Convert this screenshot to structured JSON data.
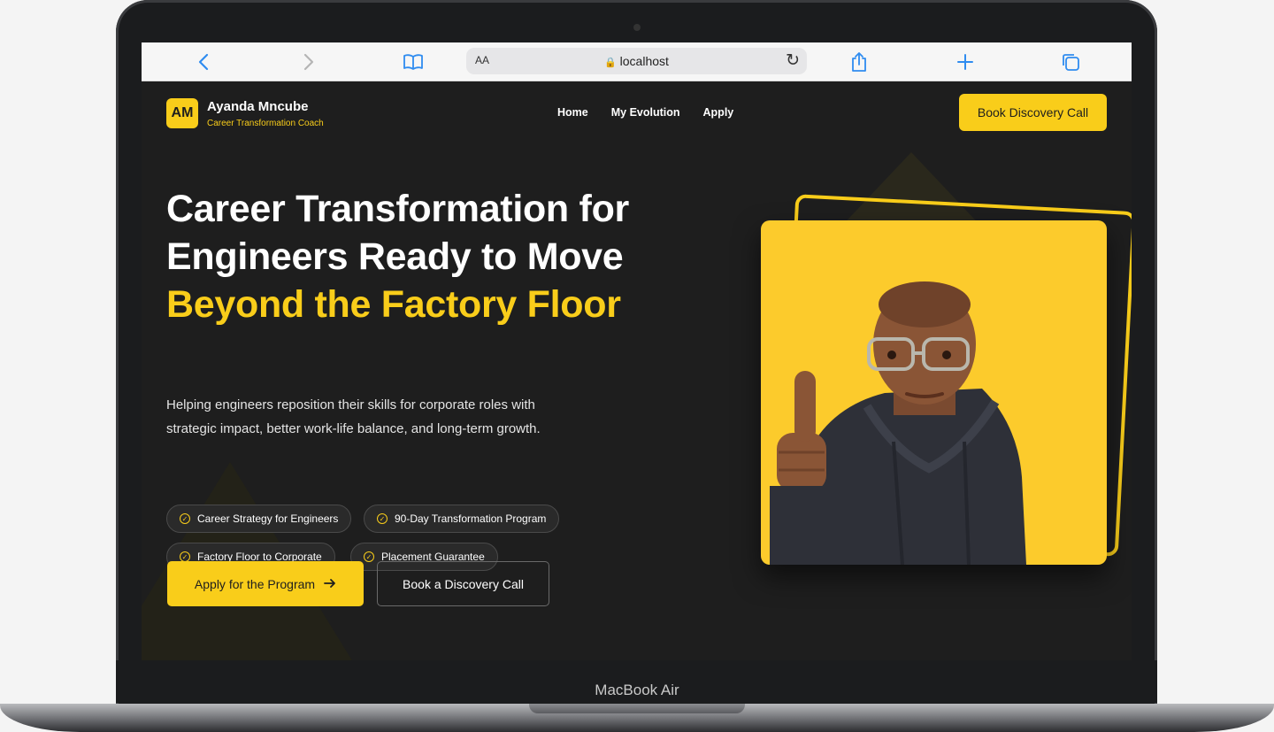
{
  "device": {
    "label": "MacBook Air"
  },
  "browser": {
    "text_size_label": "AA",
    "url": "localhost",
    "icons": {
      "back": "chevron-left-icon",
      "forward": "chevron-right-icon",
      "bookmarks": "book-icon",
      "reload": "reload-icon",
      "share": "share-icon",
      "new_tab": "plus-icon",
      "tabs": "tabs-icon",
      "secure": "lock-icon"
    }
  },
  "header": {
    "logo_initials": "AM",
    "name": "Ayanda Mncube",
    "tagline": "Career Transformation Coach",
    "nav": [
      {
        "label": "Home"
      },
      {
        "label": "My Evolution"
      },
      {
        "label": "Apply"
      }
    ],
    "cta_label": "Book Discovery Call"
  },
  "hero": {
    "headline_part1": "Career Transformation for Engineers Ready to Move ",
    "headline_highlight": "Beyond the Factory Floor",
    "lede": "Helping engineers reposition their skills for corporate roles with strategic impact, better work-life balance, and long-term growth.",
    "tags": [
      {
        "label": "Career Strategy for Engineers"
      },
      {
        "label": "90-Day Transformation Program"
      },
      {
        "label": "Factory Floor to Corporate"
      },
      {
        "label": "Placement Guarantee"
      }
    ],
    "primary_button": "Apply for the Program",
    "primary_button_icon": "arrow-right-icon",
    "secondary_button": "Book a Discovery Call"
  },
  "colors": {
    "accent": "#f9cd1a",
    "background": "#1e1e1e",
    "text": "#ffffff"
  }
}
